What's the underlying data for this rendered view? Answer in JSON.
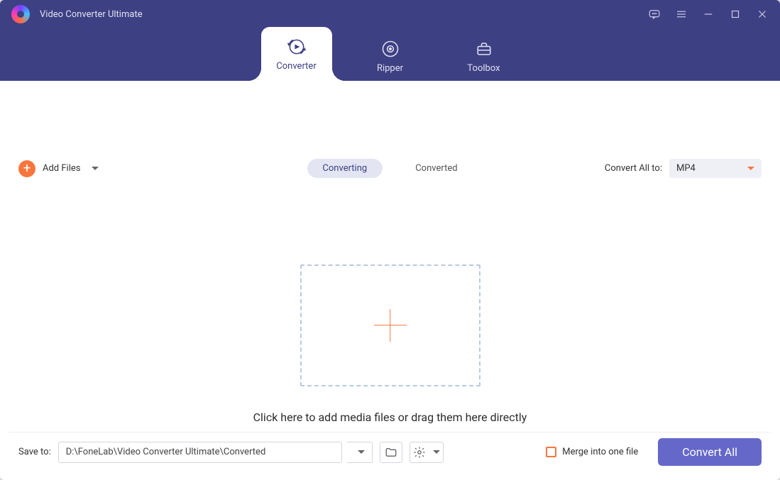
{
  "app": {
    "title": "Video Converter Ultimate"
  },
  "tabs": {
    "items": [
      {
        "label": "Converter"
      },
      {
        "label": "Ripper"
      },
      {
        "label": "Toolbox"
      }
    ]
  },
  "toolbar": {
    "add_files_label": "Add Files",
    "subtab_converting": "Converting",
    "subtab_converted": "Converted",
    "convert_all_to_label": "Convert All to:",
    "format_value": "MP4"
  },
  "drop": {
    "hint": "Click here to add media files or drag them here directly"
  },
  "footer": {
    "save_to_label": "Save to:",
    "save_path": "D:\\FoneLab\\Video Converter Ultimate\\Converted",
    "merge_label": "Merge into one file",
    "convert_all_button": "Convert All"
  }
}
